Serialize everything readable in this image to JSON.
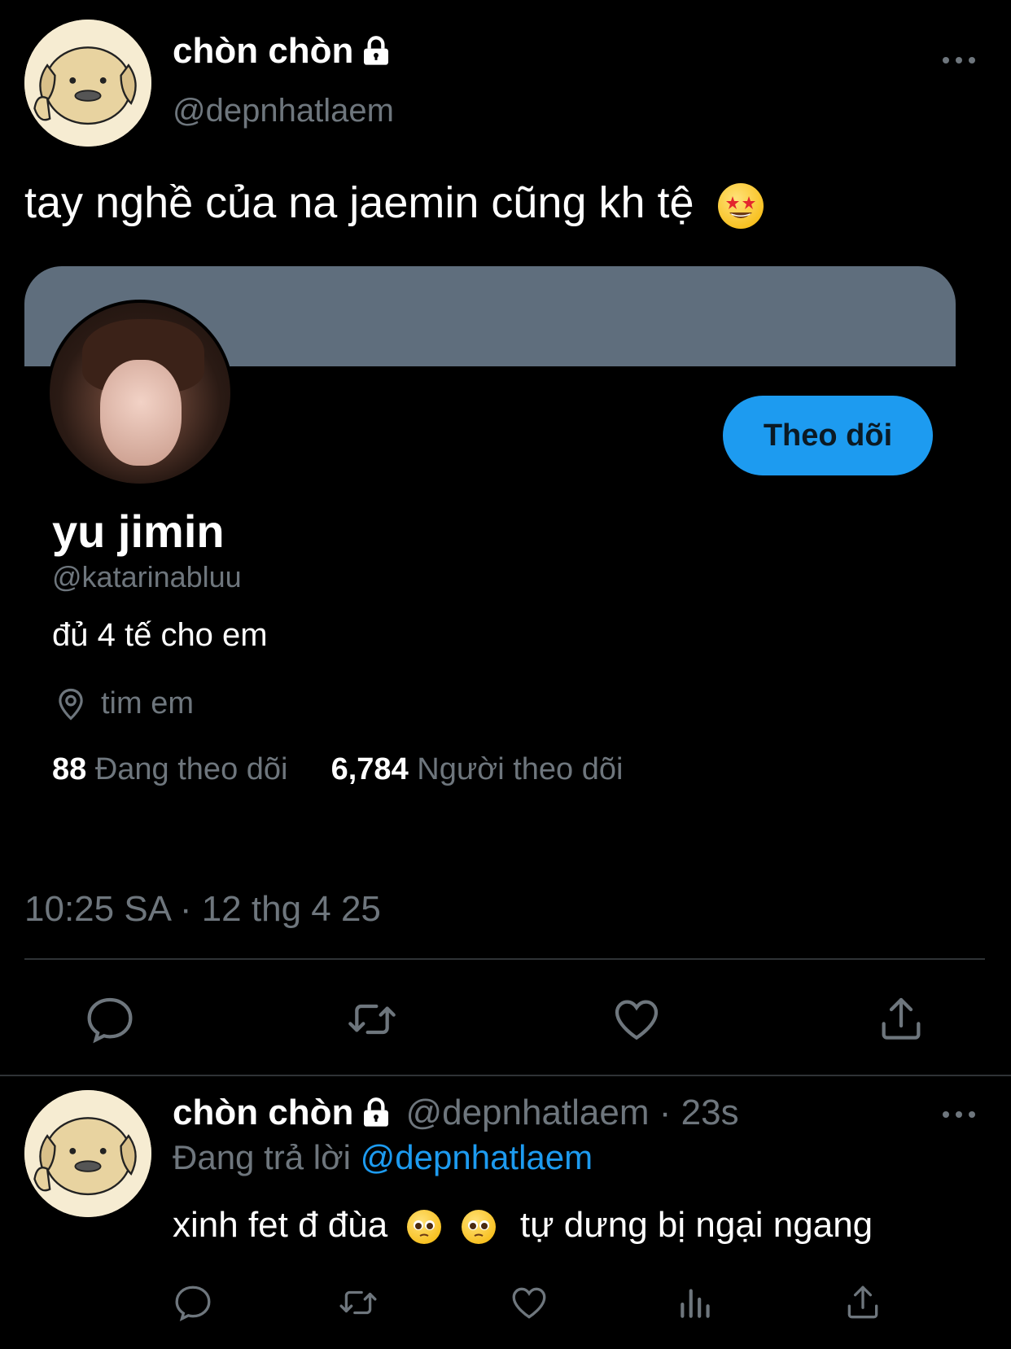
{
  "tweet": {
    "display_name": "chòn chòn",
    "handle": "@depnhatlaem",
    "text": "tay nghề của na jaemin cũng kh tệ",
    "emoji": "star-struck-emoji",
    "timestamp": "10:25 SA · 12 thg 4 25"
  },
  "profile_card": {
    "name": "yu jimin",
    "handle": "@katarinabluu",
    "bio": "đủ 4 tế cho em",
    "location": "tim em",
    "following_count": "88",
    "following_label": "Đang theo dõi",
    "followers_count": "6,784",
    "followers_label": "Người theo dõi",
    "follow_button": "Theo dõi",
    "banner_color": "#5f6e7d"
  },
  "reply": {
    "display_name": "chòn chòn",
    "handle_time": "@depnhatlaem · 23s",
    "replying_label": "Đang trả lời",
    "replying_to": "@depnhatlaem",
    "text_before": "xinh fet đ đùa",
    "text_after": "tự dưng bị ngại ngang",
    "emojis": [
      "pleading-face-emoji",
      "pleading-face-emoji"
    ]
  },
  "colors": {
    "background": "#000000",
    "secondary_text": "#6e767d",
    "accent": "#1d9bf0"
  },
  "icons": {
    "actions_main": [
      "reply-icon",
      "retweet-icon",
      "like-icon",
      "share-icon"
    ],
    "actions_reply": [
      "reply-icon",
      "retweet-icon",
      "like-icon",
      "analytics-icon",
      "share-icon"
    ]
  }
}
